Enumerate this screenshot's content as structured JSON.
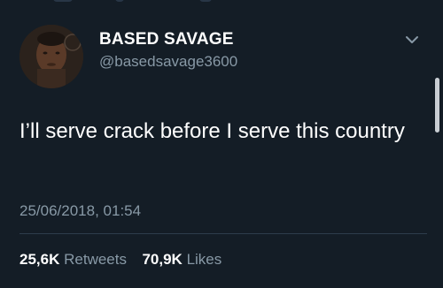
{
  "user": {
    "name": "BASED SAVAGE",
    "handle": "@basedsavage3600"
  },
  "tweet": {
    "text": "I’ll serve crack before I serve this country",
    "timestamp": "25/06/2018, 01:54"
  },
  "stats": {
    "retweets_count": "25,6K",
    "retweets_label": "Retweets",
    "likes_count": "70,9K",
    "likes_label": "Likes"
  },
  "icons": {
    "menu": "chevron-down-icon",
    "avatar": "avatar"
  },
  "colors": {
    "background": "#141d26",
    "primary_text": "#ffffff",
    "secondary_text": "#8899a6",
    "divider": "#2e3d4c"
  }
}
